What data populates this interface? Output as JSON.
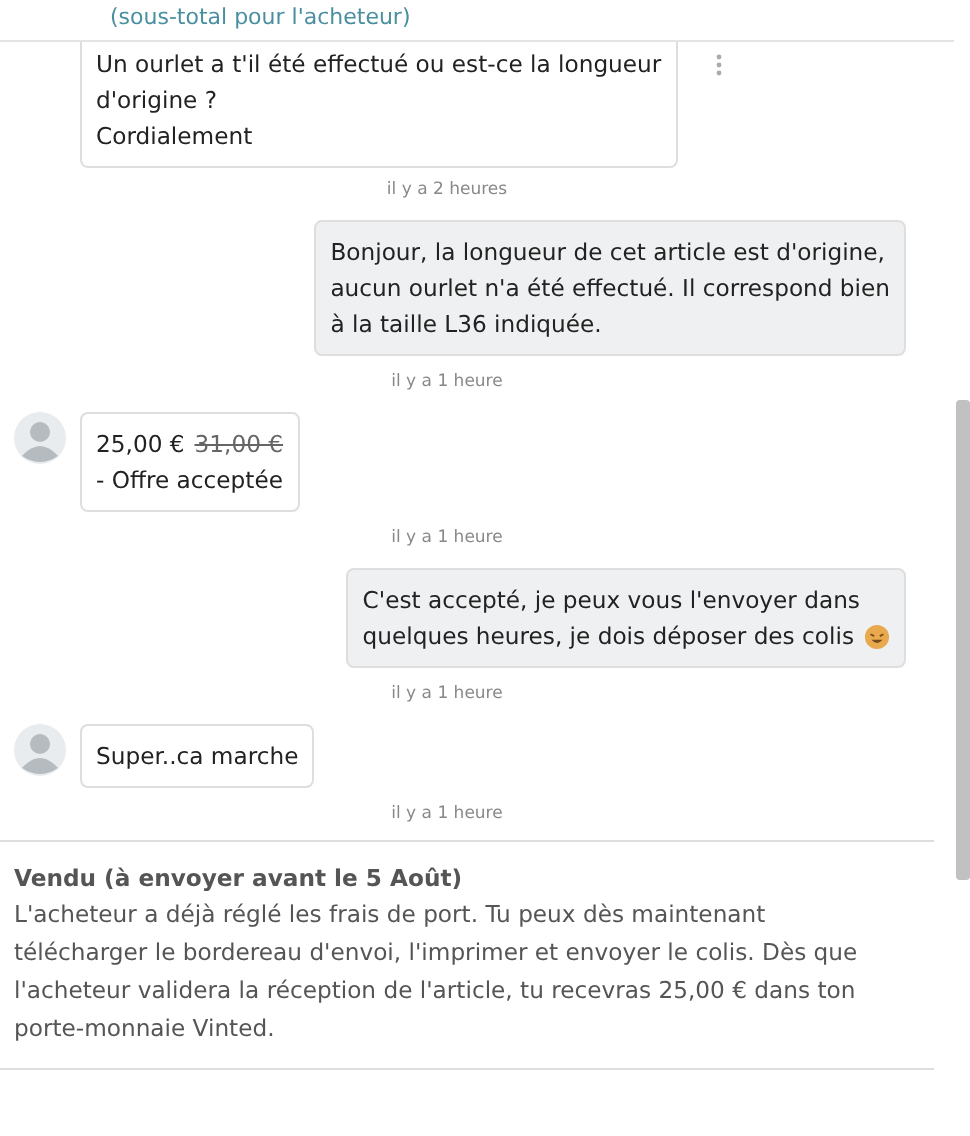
{
  "header": {
    "subtitle": "(sous-total pour l'acheteur)"
  },
  "messages": [
    {
      "kind": "text",
      "from_me": false,
      "avatar": false,
      "menu": true,
      "lines": [
        "Un ourlet a t'il été effectué ou est-ce la longueur",
        "d'origine ?",
        "Cordialement"
      ],
      "time": "il y a 2 heures"
    },
    {
      "kind": "text",
      "from_me": true,
      "menu": false,
      "lines": [
        "Bonjour, la longueur de cet article est d'origine,",
        "aucun ourlet n'a été effectué. Il correspond bien",
        "à la taille L36 indiquée."
      ],
      "time": "il y a 1 heure"
    },
    {
      "kind": "offer",
      "from_me": false,
      "avatar": true,
      "menu": false,
      "price": "25,00 €",
      "original_price": "31,00 €",
      "status": "- Offre acceptée",
      "time": "il y a 1 heure"
    },
    {
      "kind": "text",
      "from_me": true,
      "menu": false,
      "smiley": true,
      "lines": [
        "C'est accepté, je peux vous l'envoyer dans",
        "quelques heures, je dois déposer des colis"
      ],
      "time": "il y a 1 heure"
    },
    {
      "kind": "text",
      "from_me": false,
      "avatar": true,
      "menu": false,
      "lines": [
        "Super..ca marche"
      ],
      "time": "il y a 1 heure"
    }
  ],
  "status_panel": {
    "title": "Vendu (à envoyer avant le 5 Août)",
    "body": "L'acheteur a déjà réglé les frais de port. Tu peux dès maintenant télécharger le bordereau d'envoi, l'imprimer et envoyer le colis. Dès que l'acheteur validera la réception de l'article, tu recevras 25,00 € dans ton porte-monnaie Vinted."
  }
}
